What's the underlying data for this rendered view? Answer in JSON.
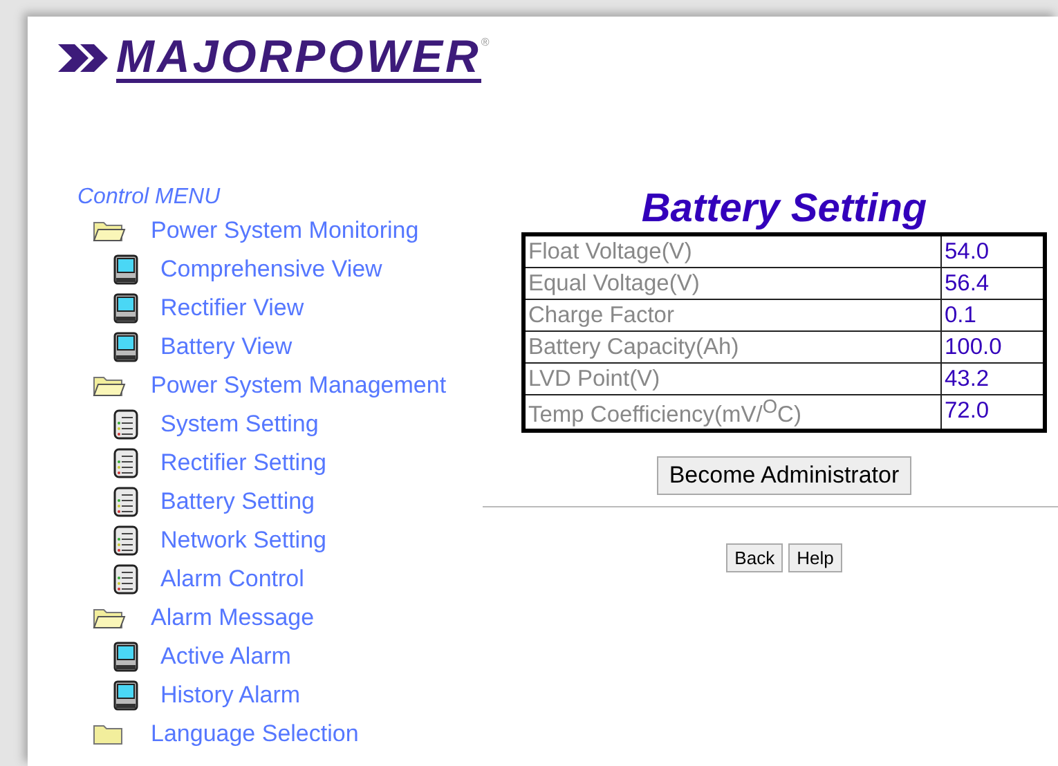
{
  "logo": {
    "name": "MAJORPOWER",
    "mark": "®"
  },
  "menu": {
    "title": "Control MENU",
    "items": [
      {
        "label": "Power System Monitoring",
        "kind": "folder-open",
        "children": [
          {
            "label": "Comprehensive View",
            "kind": "monitor"
          },
          {
            "label": "Rectifier View",
            "kind": "monitor"
          },
          {
            "label": "Battery View",
            "kind": "monitor"
          }
        ]
      },
      {
        "label": "Power System Management",
        "kind": "folder-open",
        "children": [
          {
            "label": "System Setting",
            "kind": "list"
          },
          {
            "label": "Rectifier Setting",
            "kind": "list"
          },
          {
            "label": "Battery Setting",
            "kind": "list"
          },
          {
            "label": "Network Setting",
            "kind": "list"
          },
          {
            "label": "Alarm Control",
            "kind": "list"
          }
        ]
      },
      {
        "label": "Alarm Message",
        "kind": "folder-open",
        "children": [
          {
            "label": "Active Alarm",
            "kind": "monitor"
          },
          {
            "label": "History Alarm",
            "kind": "monitor"
          }
        ]
      },
      {
        "label": "Language Selection",
        "kind": "folder"
      }
    ]
  },
  "page": {
    "title": "Battery Setting",
    "rows": [
      {
        "name": "Float Voltage(V)",
        "value": "54.0"
      },
      {
        "name": "Equal Voltage(V)",
        "value": "56.4"
      },
      {
        "name": "Charge Factor",
        "value": "0.1"
      },
      {
        "name": "Battery Capacity(Ah)",
        "value": "100.0"
      },
      {
        "name": "LVD Point(V)",
        "value": "43.2"
      },
      {
        "name": "Temp Coefficiency(mV/$^{O}$C)",
        "value": "72.0"
      }
    ],
    "admin_button": "Become Administrator",
    "buttons": [
      "Back",
      "Help"
    ]
  }
}
